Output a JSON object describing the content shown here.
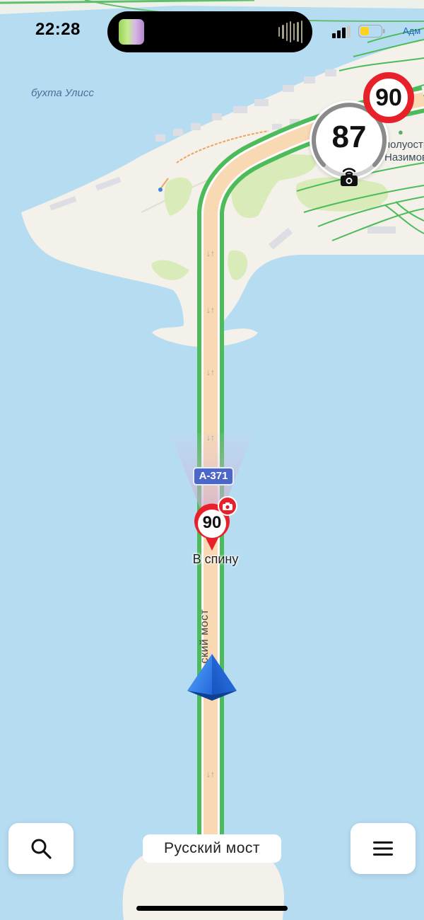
{
  "status_bar": {
    "time": "22:28",
    "carrier_text": "Адм",
    "signal_icon": "cellular-signal-icon",
    "battery_icon": "battery-icon",
    "battery_color": "#ffd21f"
  },
  "map": {
    "bay_label": "бухта Улисс",
    "poi_label_line1": "полуостро",
    "poi_label_line2": "Назимова",
    "road_name": "Русский мост",
    "road_name_partial": "ский мост",
    "route_number": "А-371",
    "camera_speed_limit": "90",
    "camera_label": "В спину",
    "water_color": "#b6dcf2",
    "land_color": "#f4f1ea",
    "route_color": "#4cbc5a",
    "route_fill_color": "#f8d9b4"
  },
  "speed": {
    "current": "87",
    "limit": "90",
    "camera_icon": "speed-camera-icon"
  },
  "bottom": {
    "search_icon": "search-icon",
    "menu_icon": "hamburger-menu-icon",
    "street_name": "Русский мост"
  }
}
